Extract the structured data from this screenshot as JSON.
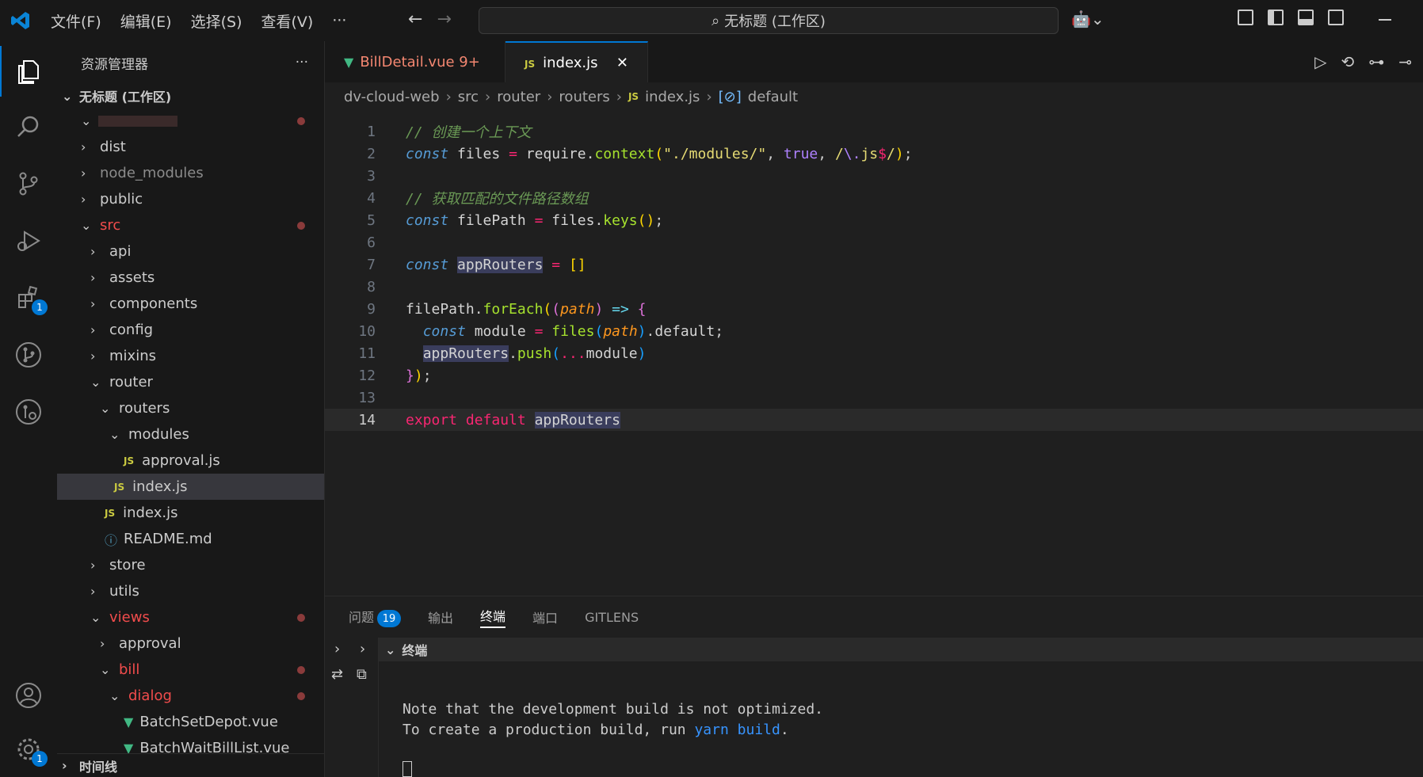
{
  "titlebar": {
    "menus": [
      "文件(F)",
      "编辑(E)",
      "选择(S)",
      "查看(V)",
      "···"
    ],
    "search": "无标题 (工作区)"
  },
  "activity": {
    "extensions_badge": "1",
    "settings_badge": "1"
  },
  "sidebar": {
    "title": "资源管理器",
    "more": "···",
    "workspace": "无标题 (工作区)",
    "tree": [
      {
        "label": "dist",
        "chev": ">",
        "indent": 30,
        "type": "folder"
      },
      {
        "label": "node_modules",
        "chev": ">",
        "indent": 30,
        "type": "folder",
        "dim": true
      },
      {
        "label": "public",
        "chev": ">",
        "indent": 30,
        "type": "folder"
      },
      {
        "label": "src",
        "chev": "⌄",
        "indent": 30,
        "type": "folder",
        "modified": true
      },
      {
        "label": "api",
        "chev": ">",
        "indent": 42,
        "type": "folder"
      },
      {
        "label": "assets",
        "chev": ">",
        "indent": 42,
        "type": "folder"
      },
      {
        "label": "components",
        "chev": ">",
        "indent": 42,
        "type": "folder"
      },
      {
        "label": "config",
        "chev": ">",
        "indent": 42,
        "type": "folder"
      },
      {
        "label": "mixins",
        "chev": ">",
        "indent": 42,
        "type": "folder"
      },
      {
        "label": "router",
        "chev": "⌄",
        "indent": 42,
        "type": "folder"
      },
      {
        "label": "routers",
        "chev": "⌄",
        "indent": 54,
        "type": "folder"
      },
      {
        "label": "approval.js",
        "chev": "",
        "indent": 84,
        "type": "js"
      },
      {
        "label": "index.js",
        "chev": "",
        "indent": 72,
        "type": "js",
        "selected": true
      },
      {
        "label": "index.js",
        "chev": "",
        "indent": 60,
        "type": "js"
      },
      {
        "label": "README.md",
        "chev": "",
        "indent": 60,
        "type": "info"
      },
      {
        "label": "store",
        "chev": ">",
        "indent": 42,
        "type": "folder"
      },
      {
        "label": "utils",
        "chev": ">",
        "indent": 42,
        "type": "folder"
      },
      {
        "label": "views",
        "chev": "⌄",
        "indent": 42,
        "type": "folder",
        "modified": true
      },
      {
        "label": "approval",
        "chev": ">",
        "indent": 54,
        "type": "folder"
      },
      {
        "label": "bill",
        "chev": "⌄",
        "indent": 54,
        "type": "folder",
        "modified": true
      },
      {
        "label": "dialog",
        "chev": "⌄",
        "indent": 66,
        "type": "folder",
        "modified": true
      },
      {
        "label": "BatchSetDepot.vue",
        "chev": "",
        "indent": 84,
        "type": "vue"
      },
      {
        "label": "BatchWaitBillList.vue",
        "chev": "",
        "indent": 84,
        "type": "vue"
      }
    ],
    "modules_label": "modules",
    "footer": "时间线"
  },
  "tabs": [
    {
      "label": "BillDetail.vue 9+",
      "icon": "vue"
    },
    {
      "label": "index.js",
      "icon": "js",
      "close": "✕"
    }
  ],
  "breadcrumb": [
    "dv-cloud-web",
    "src",
    "router",
    "routers",
    "index.js",
    "default"
  ],
  "code": {
    "line_numbers": [
      "1",
      "2",
      "3",
      "4",
      "5",
      "6",
      "7",
      "8",
      "9",
      "10",
      "11",
      "12",
      "13",
      "14"
    ]
  },
  "panel": {
    "tabs": [
      "问题",
      "输出",
      "终端",
      "端口",
      "GITLENS"
    ],
    "problems_count": "19",
    "terminal_title": "终端",
    "output_lines": [
      "Note that the development build is not optimized.",
      "To create a production build, run "
    ],
    "yarn_cmd": "yarn build",
    "period": "."
  }
}
